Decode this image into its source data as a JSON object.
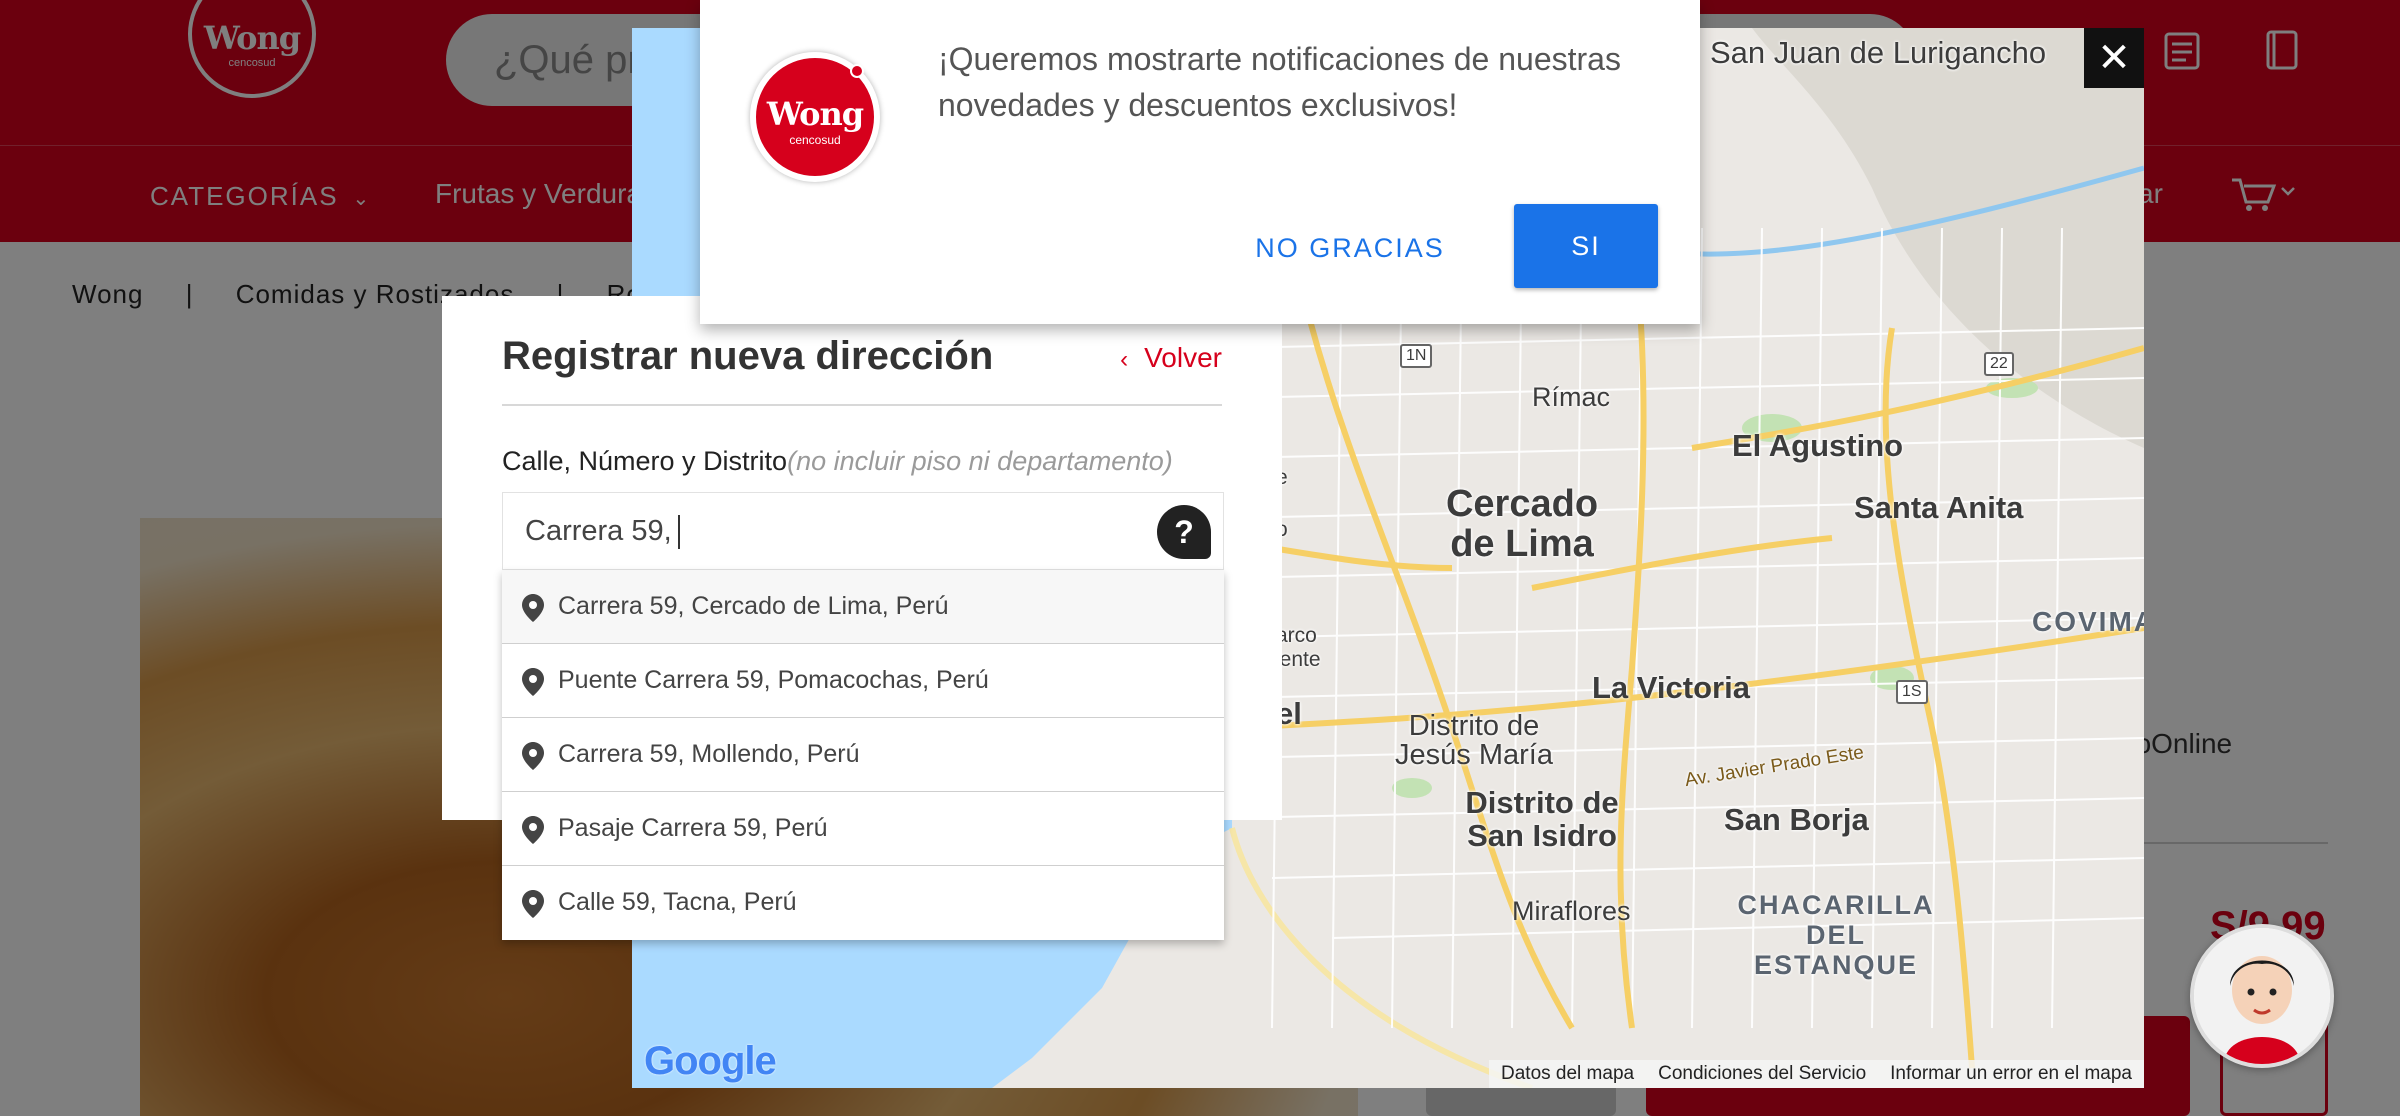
{
  "header": {
    "logo_brand": "Wong",
    "logo_sub": "cencosud",
    "search_placeholder": "¿Qué pr",
    "nav_categories": "CATEGORÍAS",
    "nav_fruits": "Frutas y Verdura",
    "nav_right_text": "ar"
  },
  "breadcrumb": {
    "items": [
      "Wong",
      "Comidas y Rostizados",
      "Rostiz"
    ],
    "separator": "|"
  },
  "product": {
    "availability_text": "Online",
    "availability_prefix": "Lo",
    "price": "S/9.99"
  },
  "map": {
    "labels": {
      "san_juan": "San Juan de Lurigancho",
      "rimac": "Rímac",
      "el_agustino": "El Agustino",
      "cercado": "Cercado de Lima",
      "santa_anita": "Santa Anita",
      "covima": "COVIMA",
      "la_victoria": "La Victoria",
      "jesus_maria": "Distrito de Jesús María",
      "san_isidro": "Distrito de San Isidro",
      "san_borja": "San Borja",
      "miraflores": "Miraflores",
      "chacarilla": "CHACARILLA DEL ESTANQUE",
      "javier_prado": "Av. Javier Prado Este",
      "arco": "arco",
      "ente": "nente",
      "el": "el",
      "e": "e",
      "o": "o",
      "shield_1n": "1N",
      "shield_22": "22",
      "shield_1s": "1S"
    },
    "footer": {
      "map_data": "Datos del mapa",
      "terms": "Condiciones del Servicio",
      "report": "Informar un error en el mapa"
    },
    "google_logo": "Google"
  },
  "close_label": "✕",
  "address_dialog": {
    "title": "Registrar nueva dirección",
    "back_label": "Volver",
    "field_label": "Calle, Número y Distrito",
    "field_hint": "(no incluir piso ni departamento)",
    "input_value": "Carrera 59,",
    "help_label": "?",
    "suggestions": [
      "Carrera 59, Cercado de Lima, Perú",
      "Puente Carrera 59, Pomacochas, Perú",
      "Carrera 59, Mollendo, Perú",
      "Pasaje Carrera 59, Perú",
      "Calle 59, Tacna, Perú"
    ]
  },
  "notification": {
    "logo_brand": "Wong",
    "logo_sub": "cencosud",
    "message": "¡Queremos mostrarte notificaciones de nuestras novedades y descuentos exclusivos!",
    "decline_label": "NO GRACIAS",
    "accept_label": "SI"
  },
  "colors": {
    "brand_red": "#d6001c",
    "accept_blue": "#1a73e8",
    "water_blue": "#aadaff",
    "map_land": "#ebe8e4",
    "road_yellow": "#f6cf65"
  }
}
